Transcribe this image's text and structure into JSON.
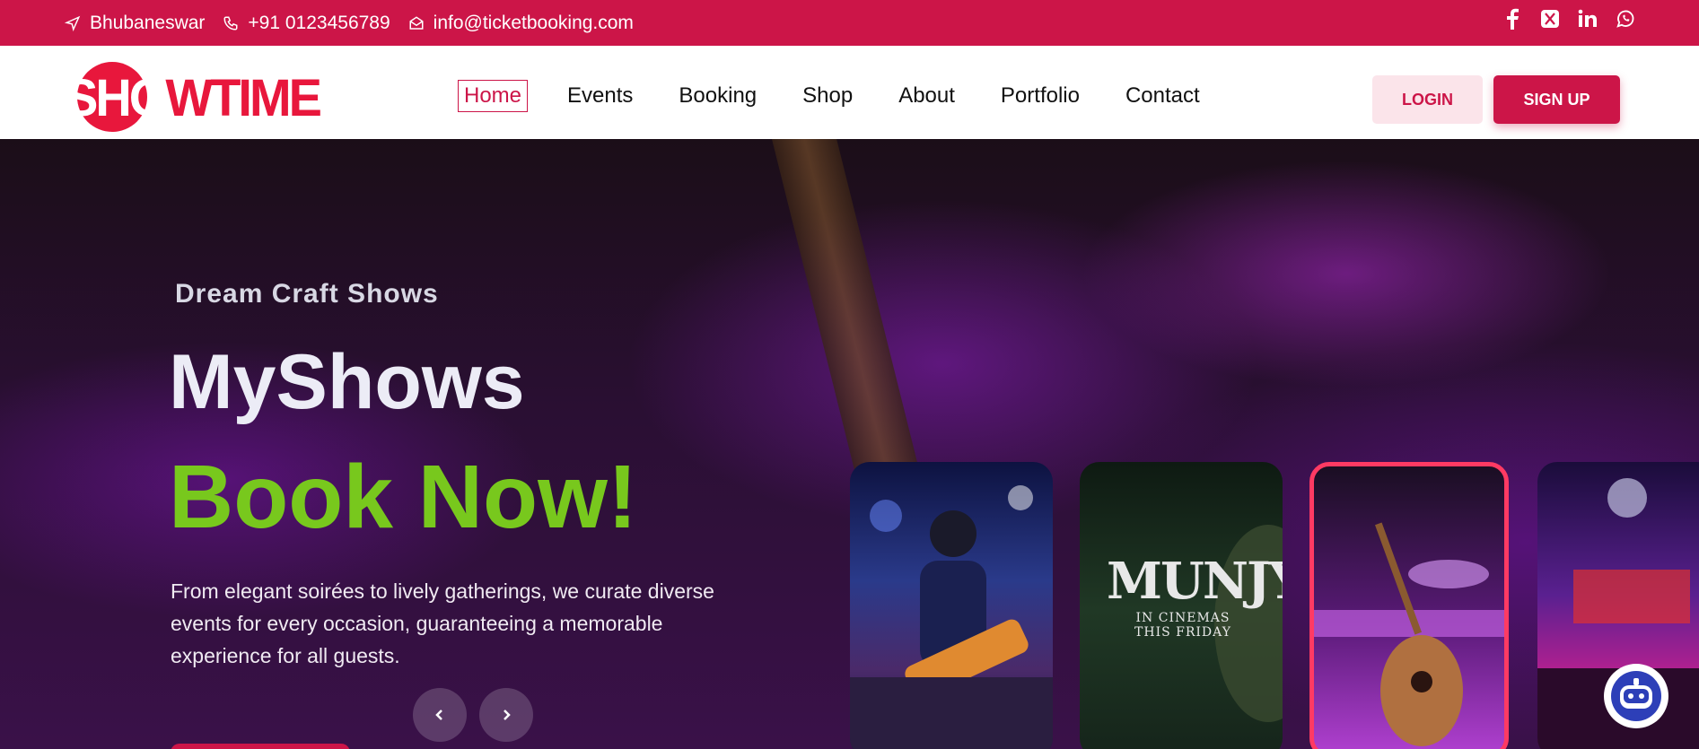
{
  "topbar": {
    "location": "Bhubaneswar",
    "phone": "+91 0123456789",
    "email": "info@ticketbooking.com",
    "social": [
      "facebook-icon",
      "x-icon",
      "linkedin-icon",
      "whatsapp-icon"
    ]
  },
  "logo": {
    "part1": "SHO",
    "part2": "WTIME"
  },
  "nav": {
    "items": [
      {
        "label": "Home",
        "active": true
      },
      {
        "label": "Events"
      },
      {
        "label": "Booking"
      },
      {
        "label": "Shop"
      },
      {
        "label": "About"
      },
      {
        "label": "Portfolio"
      },
      {
        "label": "Contact"
      }
    ],
    "login": "LOGIN",
    "signup": "SIGN UP"
  },
  "hero": {
    "tag": "Dream Craft Shows",
    "title1": "MyShows",
    "title2": "Book Now!",
    "description": "From elegant soirées to lively gatherings, we curate diverse events for every occasion, guaranteeing a memorable experience for all guests."
  },
  "cards": {
    "movie_title": "MUNJYA",
    "movie_sub1": "IN CINEMAS",
    "movie_sub2": "THIS FRIDAY"
  },
  "colors": {
    "brand": "#cc1548",
    "accent_green": "#78c81d"
  }
}
